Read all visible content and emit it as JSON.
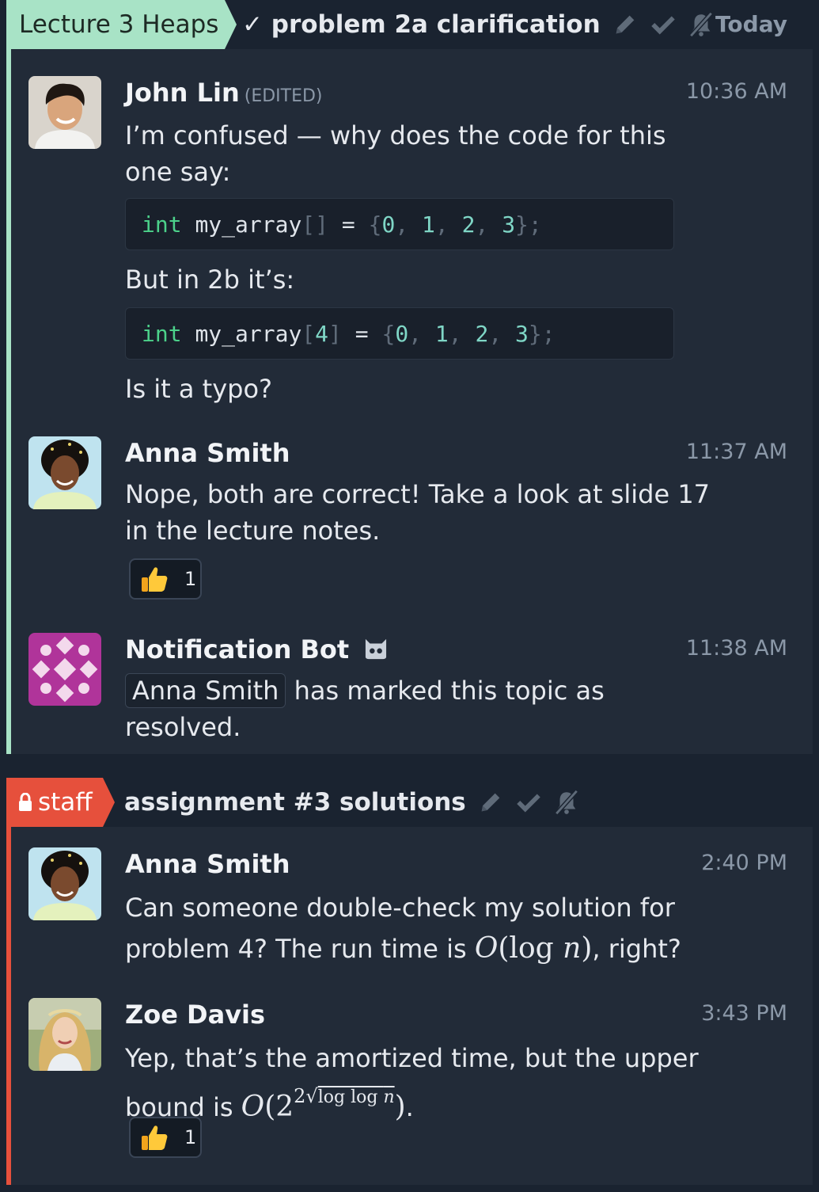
{
  "colors": {
    "background": "#1a2330",
    "panel": "#222b38",
    "stream1": "#a8e3c6",
    "stream2": "#e6503c",
    "muted": "#8b98a8"
  },
  "topic1": {
    "stream": "Lecture 3 Heaps",
    "topic": "✓ problem 2a clarification",
    "date": "Today",
    "icons": [
      "edit-icon",
      "check-icon",
      "mute-icon"
    ],
    "messages": [
      {
        "sender": "John Lin",
        "edited": "(EDITED)",
        "time": "10:36 AM",
        "text1": "I’m confused — why does the code for this",
        "text2": "one say:",
        "code1": {
          "kw": "int",
          "name": "my_array",
          "open": "[",
          "size": "",
          "close": "]",
          "eq": "=",
          "vals": [
            "0",
            "1",
            "2",
            "3"
          ],
          "end": "};"
        },
        "text3": "But in 2b it’s:",
        "code2": {
          "kw": "int",
          "name": "my_array",
          "open": "[",
          "size": "4",
          "close": "]",
          "eq": "=",
          "vals": [
            "0",
            "1",
            "2",
            "3"
          ],
          "end": "};"
        },
        "text4": "Is it a typo?"
      },
      {
        "sender": "Anna Smith",
        "time": "11:37 AM",
        "text1": "Nope, both are correct! Take a look at slide 17",
        "text2": "in the lecture notes.",
        "reaction": {
          "emoji": "thumbs-up",
          "count": "1"
        }
      },
      {
        "sender": "Notification Bot",
        "badge": "bot-icon",
        "time": "11:38 AM",
        "mention": "Anna Smith",
        "text1": "has marked this topic as",
        "text2": "resolved."
      }
    ]
  },
  "topic2": {
    "stream": "staff",
    "stream_icon": "lock-icon",
    "topic": "assignment #3 solutions",
    "icons": [
      "edit-icon",
      "check-icon",
      "mute-icon"
    ],
    "messages": [
      {
        "sender": "Anna Smith",
        "time": "2:40 PM",
        "text1": "Can someone double-check my solution for",
        "text2": "problem 4? The run time is",
        "math": "O(log n)",
        "text2_end": ", right?"
      },
      {
        "sender": "Zoe Davis",
        "time": "3:43 PM",
        "text1": "Yep, that’s the amortized time, but the upper",
        "text2": "bound is",
        "math": "O(2^(2^√(log log n)))",
        "text2_end": ".",
        "reaction": {
          "emoji": "thumbs-up",
          "count": "1"
        }
      }
    ]
  }
}
